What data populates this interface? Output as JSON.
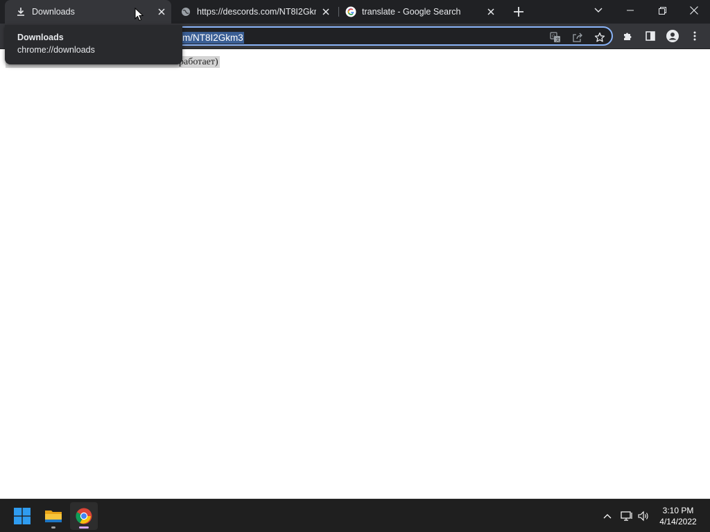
{
  "tabs": [
    {
      "title": "Downloads",
      "icon": "download-icon",
      "active": true
    },
    {
      "title": "https://descords.com/NT8I2Gkm3",
      "icon": "globe-icon",
      "active": false
    },
    {
      "title": "translate - Google Search",
      "icon": "google-icon",
      "active": false
    }
  ],
  "tooltip": {
    "title": "Downloads",
    "subtitle": "chrome://downloads"
  },
  "omnibox": {
    "url_visible": "m/NT8I2Gkm3"
  },
  "page": {
    "text_visible": "работает)"
  },
  "taskbar": {
    "apps": [
      {
        "name": "Start",
        "icon": "windows-start-icon"
      },
      {
        "name": "File Explorer",
        "icon": "folder-icon"
      },
      {
        "name": "Google Chrome",
        "icon": "chrome-icon"
      }
    ],
    "time": "3:10 PM",
    "date": "4/14/2022"
  },
  "colors": {
    "tabstrip": "#202124",
    "active_tab": "#35363a",
    "omnibox_focus": "#8ab4f8",
    "url_selection": "#3a5e94",
    "taskbar": "#1f1f1f"
  }
}
